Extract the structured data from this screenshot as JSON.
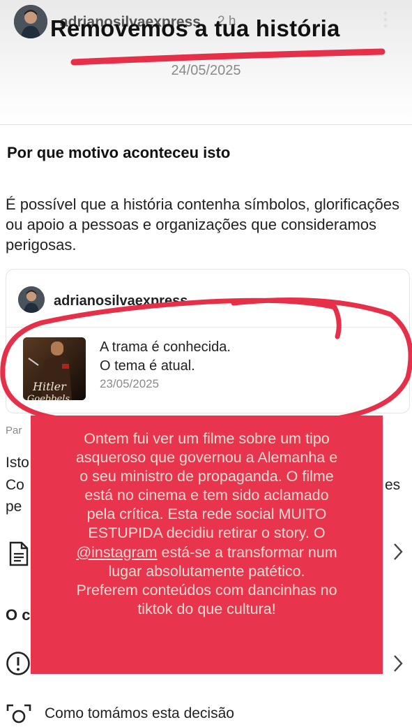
{
  "story": {
    "username": "adrianosilvaexpress",
    "time": "2 h"
  },
  "header": {
    "title": "Removemos a tua história",
    "date": "24/05/2025"
  },
  "reason": {
    "heading": "Por que motivo aconteceu isto",
    "body": "É possível que a história contenha símbolos, glorificações ou apoio a pessoas e organizações que consideramos perigosas."
  },
  "post": {
    "username": "adrianosilvaexpress",
    "line1": "A trama  é conhecida.",
    "line2": "O tema é atual.",
    "date": "23/05/2025",
    "thumb_text_1": "Hitler",
    "thumb_text_2": "Goebbels"
  },
  "partial": {
    "par": "Par",
    "isto": "Isto",
    "co": "Co",
    "es": "es",
    "per": "pe",
    "oc": "O c",
    "bottom": "Como tomámos esta decisão"
  },
  "overlay": {
    "lines": [
      "Ontem fui ver um filme sobre um tipo",
      "asqueroso que governou a Alemanha e",
      "o seu ministro de propaganda. O filme",
      "está no cinema e tem sido aclamado",
      "pela crítica. Esta rede social MUITO",
      "ESTUPIDA decidiu retirar o story. O",
      "está-se a transformar num",
      "lugar absolutamente patético.",
      "Preferem conteúdos com dancinhas no",
      "tiktok do que cultura!"
    ],
    "mention": "@instagram"
  },
  "colors": {
    "overlay": "#e8344c",
    "annotation": "#e6304a"
  }
}
